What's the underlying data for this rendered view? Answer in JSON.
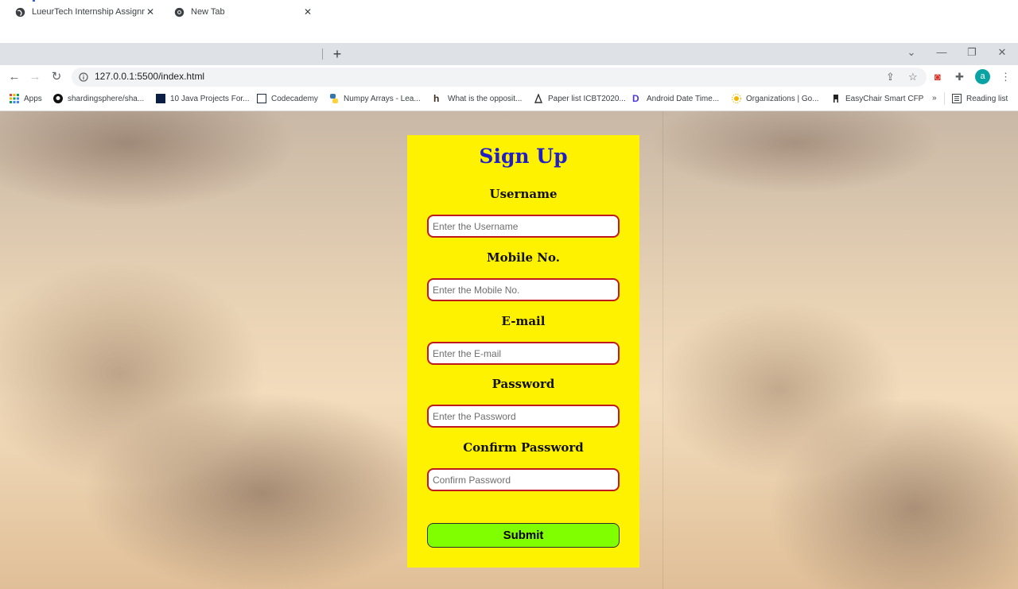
{
  "browser": {
    "tabs": [
      {
        "title": "LueurTech Internship Assignment",
        "active": true
      },
      {
        "title": "New Tab",
        "active": false
      }
    ],
    "url": "127.0.0.1:5500/index.html",
    "profile_initial": "a",
    "bookmarks": [
      {
        "label": "Apps",
        "icon": "apps-grid-icon"
      },
      {
        "label": "shardingsphere/sha...",
        "icon": "github-icon"
      },
      {
        "label": "10 Java Projects For...",
        "icon": "c-logo-icon"
      },
      {
        "label": "Codecademy",
        "icon": "codecademy-icon"
      },
      {
        "label": "Numpy Arrays - Lea...",
        "icon": "python-icon"
      },
      {
        "label": "What is the opposit...",
        "icon": "h-logo-icon"
      },
      {
        "label": "Paper list ICBT2020...",
        "icon": "paper-icon"
      },
      {
        "label": "Android Date Time...",
        "icon": "d-logo-icon"
      },
      {
        "label": "Organizations | Go...",
        "icon": "sun-icon"
      },
      {
        "label": "EasyChair Smart CFP",
        "icon": "easychair-icon"
      }
    ],
    "overflow_label": "»",
    "reading_list_label": "Reading list"
  },
  "form": {
    "title": "Sign Up",
    "fields": [
      {
        "label": "Username",
        "placeholder": "Enter the Username"
      },
      {
        "label": "Mobile No.",
        "placeholder": "Enter the Mobile No."
      },
      {
        "label": "E-mail",
        "placeholder": "Enter the E-mail"
      },
      {
        "label": "Password",
        "placeholder": "Enter the Password"
      },
      {
        "label": "Confirm Password",
        "placeholder": "Confirm Password"
      }
    ],
    "submit_label": "Submit"
  },
  "colors": {
    "card_bg": "#fff200",
    "title": "#1f1fc8",
    "input_border": "#c0191f",
    "submit_bg": "#7fff00"
  }
}
